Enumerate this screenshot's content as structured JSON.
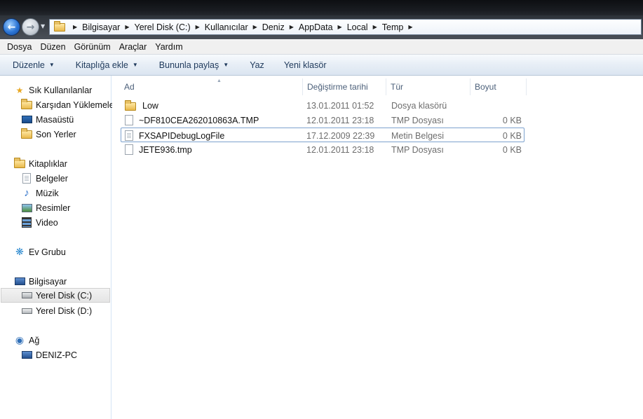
{
  "address": {
    "crumbs": [
      "Bilgisayar",
      "Yerel Disk (C:)",
      "Kullanıcılar",
      "Deniz",
      "AppData",
      "Local",
      "Temp"
    ]
  },
  "menu": [
    "Dosya",
    "Düzen",
    "Görünüm",
    "Araçlar",
    "Yardım"
  ],
  "commands": [
    {
      "label": "Düzenle",
      "dropdown": true
    },
    {
      "label": "Kitaplığa ekle",
      "dropdown": true
    },
    {
      "label": "Bununla paylaş",
      "dropdown": true
    },
    {
      "label": "Yaz",
      "dropdown": false
    },
    {
      "label": "Yeni klasör",
      "dropdown": false
    }
  ],
  "nav": {
    "favorites": "Sık Kullanılanlar",
    "downloads": "Karşıdan Yüklemeler",
    "desktop": "Masaüstü",
    "recent": "Son Yerler",
    "libraries": "Kitaplıklar",
    "documents": "Belgeler",
    "music": "Müzik",
    "pictures": "Resimler",
    "video": "Video",
    "homegroup": "Ev Grubu",
    "computer": "Bilgisayar",
    "disk_c": "Yerel Disk (C:)",
    "disk_d": "Yerel Disk (D:)",
    "network": "Ağ",
    "pc": "DENIZ-PC"
  },
  "columns": {
    "name": "Ad",
    "date": "Değiştirme tarihi",
    "type": "Tür",
    "size": "Boyut"
  },
  "files": [
    {
      "name": "Low",
      "date": "13.01.2011 01:52",
      "type": "Dosya klasörü",
      "size": "",
      "icon": "folder-icon"
    },
    {
      "name": "~DF810CEA262010863A.TMP",
      "date": "12.01.2011 23:18",
      "type": "TMP Dosyası",
      "size": "0 KB",
      "icon": "file-icon"
    },
    {
      "name": "FXSAPIDebugLogFile",
      "date": "17.12.2009 22:39",
      "type": "Metin Belgesi",
      "size": "0 KB",
      "icon": "text-file-icon"
    },
    {
      "name": "JETE936.tmp",
      "date": "12.01.2011 23:18",
      "type": "TMP Dosyası",
      "size": "0 KB",
      "icon": "file-icon"
    }
  ],
  "colors": {
    "accent": "#1e395b",
    "selection_border": "#7da2ce"
  }
}
